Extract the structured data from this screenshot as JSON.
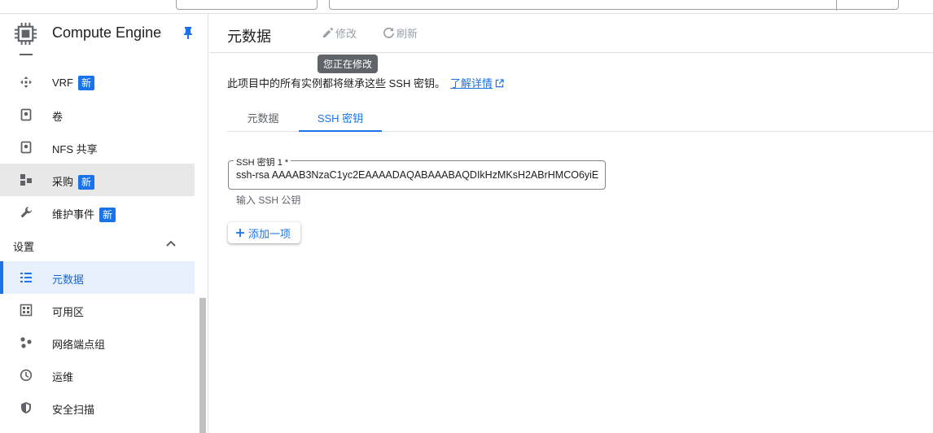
{
  "sidebar": {
    "title": "Compute Engine",
    "items": [
      {
        "label": "VRF",
        "badge": "新",
        "icon": "move-icon"
      },
      {
        "label": "卷",
        "badge": "",
        "icon": "disk-icon"
      },
      {
        "label": "NFS 共享",
        "badge": "",
        "icon": "disk-icon"
      },
      {
        "label": "采购",
        "badge": "新",
        "icon": "purchase-icon"
      },
      {
        "label": "维护事件",
        "badge": "新",
        "icon": "wrench-icon"
      }
    ],
    "section": {
      "label": "设置",
      "expanded": true
    },
    "settings_items": [
      {
        "label": "元数据",
        "icon": "list-icon",
        "active": true
      },
      {
        "label": "可用区",
        "icon": "zones-icon"
      },
      {
        "label": "网络端点组",
        "icon": "nodes-icon"
      },
      {
        "label": "运维",
        "icon": "clock-icon"
      },
      {
        "label": "安全扫描",
        "icon": "shield-icon"
      }
    ]
  },
  "main": {
    "title": "元数据",
    "edit_label": "修改",
    "refresh_label": "刷新",
    "tooltip": "您正在修改",
    "description": "此项目中的所有实例都将继承这些 SSH 密钥。",
    "learn_more": "了解详情",
    "tabs": [
      {
        "label": "元数据",
        "active": false
      },
      {
        "label": "SSH 密钥",
        "active": true
      }
    ],
    "ssh_field": {
      "label": "SSH 密钥 1 *",
      "value": "ssh-rsa AAAAB3NzaC1yc2EAAAADAQABAAABAQDIkHzMKsH2ABrHMCO6yiE",
      "hint": "输入 SSH 公钥"
    },
    "add_button": "添加一项"
  },
  "colors": {
    "accent": "#1a73e8",
    "active_bg": "#e8f0fe",
    "hover_bg": "#e8e8e8",
    "tooltip_bg": "#606368"
  }
}
